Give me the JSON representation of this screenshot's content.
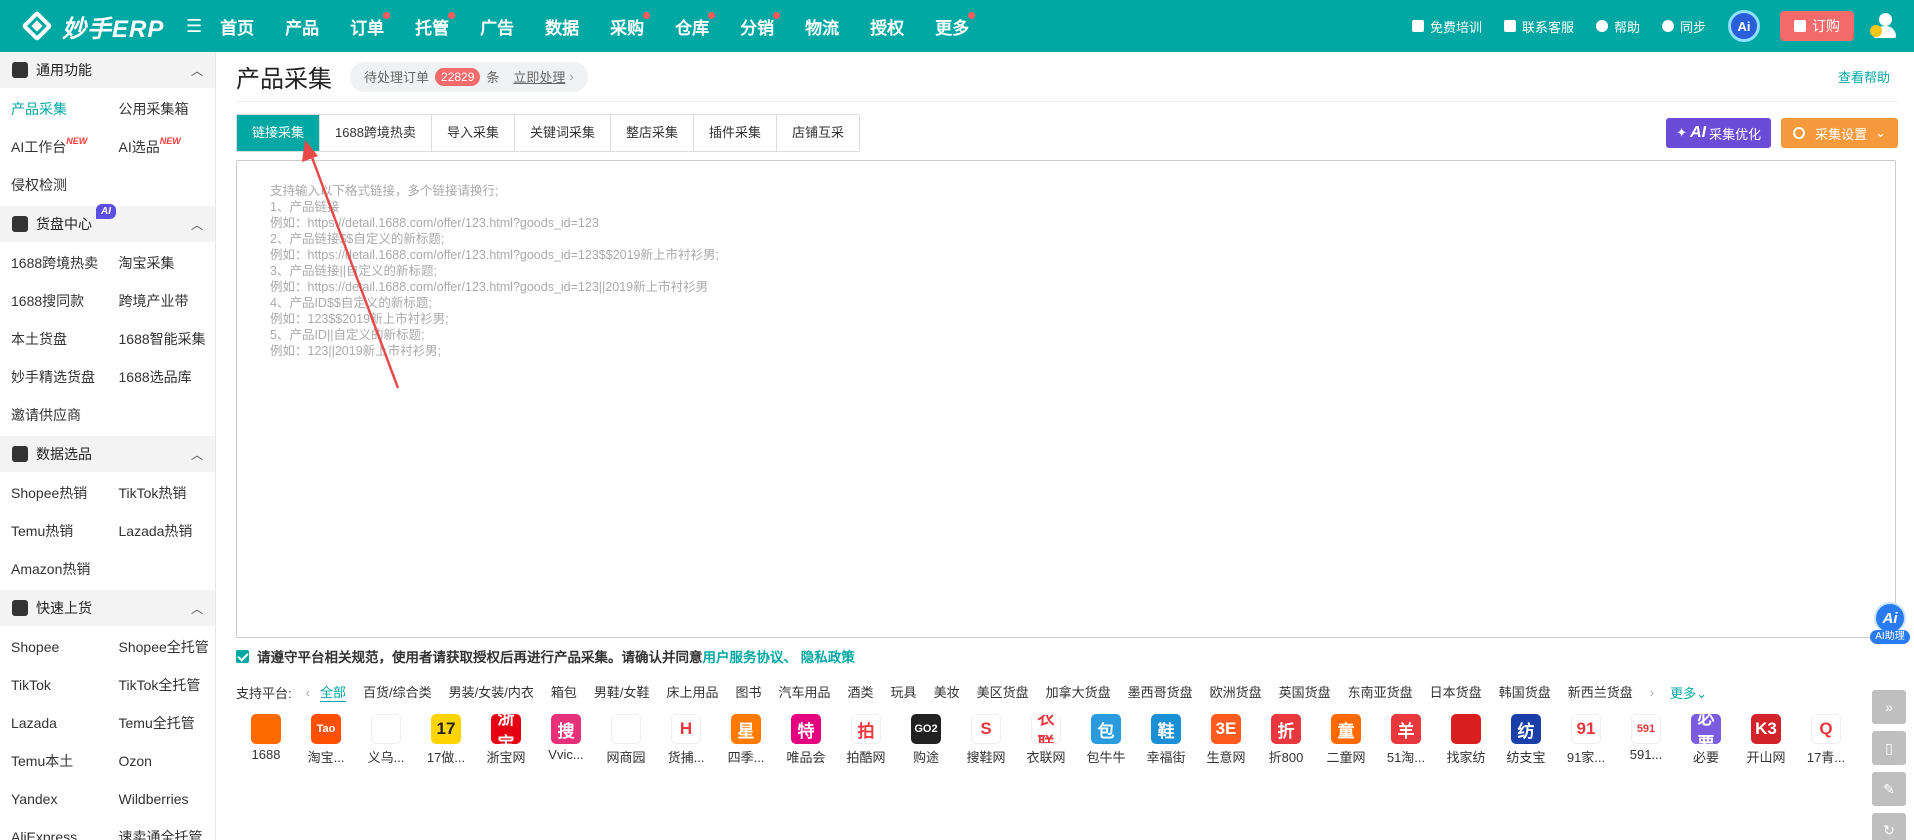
{
  "app": {
    "logo_text": "妙手ERP"
  },
  "nav": [
    {
      "label": "首页",
      "dot": false
    },
    {
      "label": "产品",
      "dot": false
    },
    {
      "label": "订单",
      "dot": true
    },
    {
      "label": "托管",
      "dot": true
    },
    {
      "label": "广告",
      "dot": false
    },
    {
      "label": "数据",
      "dot": false
    },
    {
      "label": "采购",
      "dot": true
    },
    {
      "label": "仓库",
      "dot": true
    },
    {
      "label": "分销",
      "dot": true
    },
    {
      "label": "物流",
      "dot": false
    },
    {
      "label": "授权",
      "dot": false
    },
    {
      "label": "更多",
      "dot": true
    }
  ],
  "topright": {
    "training": "免费培训",
    "support": "联系客服",
    "help": "帮助",
    "sync": "同步",
    "ai_badge": "Ai",
    "order": "订购"
  },
  "sidebar": [
    {
      "title": "通用功能",
      "ai_tag": "",
      "items": [
        {
          "label": "产品采集",
          "active": true,
          "new": ""
        },
        {
          "label": "公用采集箱",
          "active": false,
          "new": ""
        },
        {
          "label": "AI工作台",
          "active": false,
          "new": "NEW"
        },
        {
          "label": "AI选品",
          "active": false,
          "new": "NEW"
        },
        {
          "label": "侵权检测",
          "active": false,
          "new": ""
        }
      ]
    },
    {
      "title": "货盘中心",
      "ai_tag": "AI",
      "items": [
        {
          "label": "1688跨境热卖",
          "active": false,
          "new": ""
        },
        {
          "label": "淘宝采集",
          "active": false,
          "new": ""
        },
        {
          "label": "1688搜同款",
          "active": false,
          "new": ""
        },
        {
          "label": "跨境产业带",
          "active": false,
          "new": ""
        },
        {
          "label": "本土货盘",
          "active": false,
          "new": ""
        },
        {
          "label": "1688智能采集",
          "active": false,
          "new": ""
        },
        {
          "label": "妙手精选货盘",
          "active": false,
          "new": ""
        },
        {
          "label": "1688选品库",
          "active": false,
          "new": ""
        },
        {
          "label": "邀请供应商",
          "active": false,
          "new": ""
        }
      ]
    },
    {
      "title": "数据选品",
      "ai_tag": "",
      "items": [
        {
          "label": "Shopee热销",
          "active": false,
          "new": ""
        },
        {
          "label": "TikTok热销",
          "active": false,
          "new": ""
        },
        {
          "label": "Temu热销",
          "active": false,
          "new": ""
        },
        {
          "label": "Lazada热销",
          "active": false,
          "new": ""
        },
        {
          "label": "Amazon热销",
          "active": false,
          "new": ""
        }
      ]
    },
    {
      "title": "快速上货",
      "ai_tag": "",
      "items": [
        {
          "label": "Shopee",
          "active": false,
          "new": ""
        },
        {
          "label": "Shopee全托管",
          "active": false,
          "new": ""
        },
        {
          "label": "TikTok",
          "active": false,
          "new": ""
        },
        {
          "label": "TikTok全托管",
          "active": false,
          "new": ""
        },
        {
          "label": "Lazada",
          "active": false,
          "new": ""
        },
        {
          "label": "Temu全托管",
          "active": false,
          "new": ""
        },
        {
          "label": "Temu本土",
          "active": false,
          "new": ""
        },
        {
          "label": "Ozon",
          "active": false,
          "new": ""
        },
        {
          "label": "Yandex",
          "active": false,
          "new": ""
        },
        {
          "label": "Wildberries",
          "active": false,
          "new": ""
        },
        {
          "label": "AliExpress",
          "active": false,
          "new": ""
        },
        {
          "label": "速卖通全托管",
          "active": false,
          "new": ""
        }
      ]
    }
  ],
  "main": {
    "title": "产品采集",
    "pending_label": "待处理订单",
    "pending_count": "22829",
    "pending_unit": "条",
    "pending_action": "立即处理",
    "help": "查看帮助",
    "tabs": [
      {
        "label": "链接采集",
        "active": true
      },
      {
        "label": "1688跨境热卖",
        "active": false
      },
      {
        "label": "导入采集",
        "active": false
      },
      {
        "label": "关键词采集",
        "active": false
      },
      {
        "label": "整店采集",
        "active": false
      },
      {
        "label": "插件采集",
        "active": false
      },
      {
        "label": "店铺互采",
        "active": false
      }
    ],
    "ai_optimize": {
      "ai": "AI",
      "label": "采集优化"
    },
    "collect_settings": "采集设置",
    "placeholder": "支持输入以下格式链接，多个链接请换行;\n1、产品链接\n例如：https://detail.1688.com/offer/123.html?goods_id=123\n2、产品链接$$自定义的新标题;\n例如：https://detail.1688.com/offer/123.html?goods_id=123$$2019新上市衬衫男;\n3、产品链接||自定义的新标题;\n例如：https://detail.1688.com/offer/123.html?goods_id=123||2019新上市衬衫男\n4、产品ID$$自定义的新标题;\n例如：123$$2019新上市衬衫男;\n5、产品ID||自定义的新标题;\n例如：123||2019新上市衬衫男;",
    "agree_text": "请遵守平台相关规范，使用者请获取授权后再进行产品采集。请确认并同意",
    "agree_links": "用户服务协议、 隐私政策",
    "platform_label": "支持平台:",
    "platform_tabs": [
      {
        "label": "全部",
        "active": true
      },
      {
        "label": "百货/综合类",
        "active": false
      },
      {
        "label": "男装/女装/内衣",
        "active": false
      },
      {
        "label": "箱包",
        "active": false
      },
      {
        "label": "男鞋/女鞋",
        "active": false
      },
      {
        "label": "床上用品",
        "active": false
      },
      {
        "label": "图书",
        "active": false
      },
      {
        "label": "汽车用品",
        "active": false
      },
      {
        "label": "酒类",
        "active": false
      },
      {
        "label": "玩具",
        "active": false
      },
      {
        "label": "美妆",
        "active": false
      },
      {
        "label": "美区货盘",
        "active": false
      },
      {
        "label": "加拿大货盘",
        "active": false
      },
      {
        "label": "墨西哥货盘",
        "active": false
      },
      {
        "label": "欧洲货盘",
        "active": false
      },
      {
        "label": "英国货盘",
        "active": false
      },
      {
        "label": "东南亚货盘",
        "active": false
      },
      {
        "label": "日本货盘",
        "active": false
      },
      {
        "label": "韩国货盘",
        "active": false
      },
      {
        "label": "新西兰货盘",
        "active": false
      }
    ],
    "more_platforms": "更多",
    "platforms": [
      {
        "name": "1688",
        "glyph": "",
        "color": "#ff6a00"
      },
      {
        "name": "淘宝...",
        "glyph": "Tao",
        "color": "#ff5000"
      },
      {
        "name": "义乌...",
        "glyph": "",
        "color": "#ffffff"
      },
      {
        "name": "17做...",
        "glyph": "17",
        "color": "#ffd400"
      },
      {
        "name": "浙宝网",
        "glyph": "浙宝",
        "color": "#e60012"
      },
      {
        "name": "Vvic...",
        "glyph": "搜",
        "color": "#e6317a"
      },
      {
        "name": "网商园",
        "glyph": "",
        "color": "#ffffff"
      },
      {
        "name": "货捕...",
        "glyph": "H",
        "color": "#ffffff"
      },
      {
        "name": "四季...",
        "glyph": "星",
        "color": "#ff7a00"
      },
      {
        "name": "唯品会",
        "glyph": "特",
        "color": "#e4007f"
      },
      {
        "name": "拍酷网",
        "glyph": "拍",
        "color": "#ffffff"
      },
      {
        "name": "购途",
        "glyph": "GO2",
        "color": "#222222"
      },
      {
        "name": "搜鞋网",
        "glyph": "S",
        "color": "#ffffff"
      },
      {
        "name": "衣联网",
        "glyph": "衣联",
        "color": "#ffffff"
      },
      {
        "name": "包牛牛",
        "glyph": "包",
        "color": "#2a9bdc"
      },
      {
        "name": "幸福街",
        "glyph": "鞋",
        "color": "#1a8fd6"
      },
      {
        "name": "生意网",
        "glyph": "3E",
        "color": "#ff5a1f"
      },
      {
        "name": "折800",
        "glyph": "折",
        "color": "#e8383d"
      },
      {
        "name": "二童网",
        "glyph": "童",
        "color": "#ff6a00"
      },
      {
        "name": "51淘...",
        "glyph": "羊",
        "color": "#e8383d"
      },
      {
        "name": "找家纺",
        "glyph": "",
        "color": "#d81e1e"
      },
      {
        "name": "纺支宝",
        "glyph": "纺",
        "color": "#1a3fa8"
      },
      {
        "name": "91家...",
        "glyph": "91",
        "color": "#ffffff"
      },
      {
        "name": "591...",
        "glyph": "591",
        "color": "#ffffff"
      },
      {
        "name": "必要",
        "glyph": "必要",
        "color": "#7b5ce0"
      },
      {
        "name": "开山网",
        "glyph": "K3",
        "color": "#d2232a"
      },
      {
        "name": "17青...",
        "glyph": "Q",
        "color": "#ffffff"
      }
    ]
  },
  "floating": {
    "ai_label": "Ai",
    "ai_helper": "AI助理"
  },
  "colors": {
    "primary": "#00a8a3",
    "danger": "#f56b6b",
    "ai_purple": "#6b4cd6",
    "orange": "#f79a3e"
  }
}
